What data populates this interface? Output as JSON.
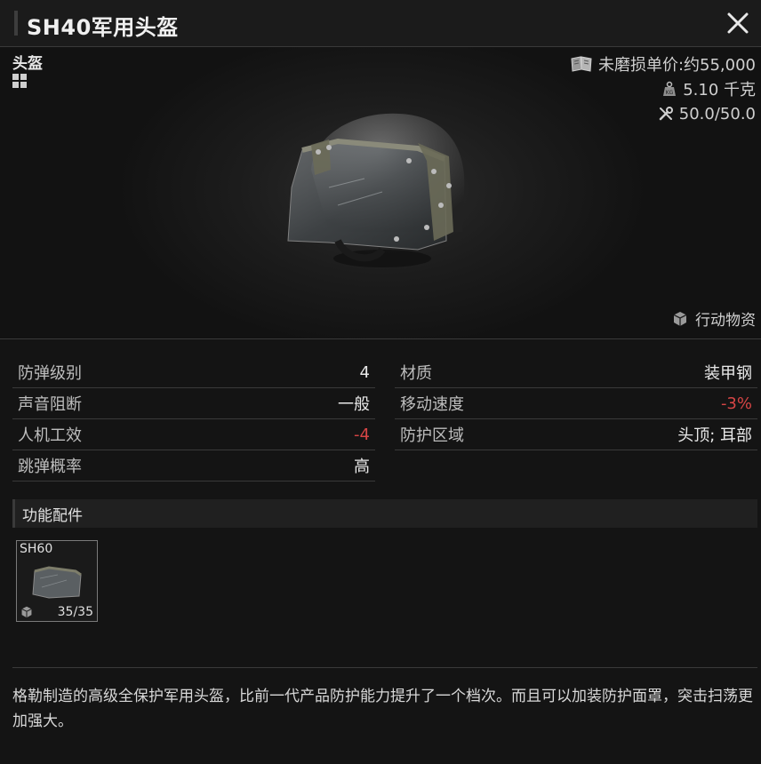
{
  "window": {
    "title": "SH40军用头盔",
    "close_icon": "close-icon"
  },
  "item": {
    "category": "头盔",
    "price": "未磨损单价:约55,000",
    "weight": "5.10 千克",
    "durability": "50.0/50.0",
    "source": "行动物资"
  },
  "stats": {
    "left": [
      {
        "label": "防弹级别",
        "value": "4"
      },
      {
        "label": "声音阻断",
        "value": "一般"
      },
      {
        "label": "人机工效",
        "value": "-4"
      },
      {
        "label": "跳弹概率",
        "value": "高"
      }
    ],
    "right": [
      {
        "label": "材质",
        "value": "装甲钢"
      },
      {
        "label": "移动速度",
        "value": "-3%"
      },
      {
        "label": "防护区域",
        "value": "头顶; 耳部"
      }
    ]
  },
  "attachments": {
    "section_title": "功能配件",
    "items": [
      {
        "name": "SH60",
        "durability": "35/35"
      }
    ]
  },
  "description": "格勒制造的高级全保护军用头盔，比前一代产品防护能力提升了一个档次。而且可以加装防护面罩，突击扫荡更加强大。",
  "colors": {
    "background": "#141414",
    "negative": "#d64545",
    "text": "#d8d8d8"
  }
}
